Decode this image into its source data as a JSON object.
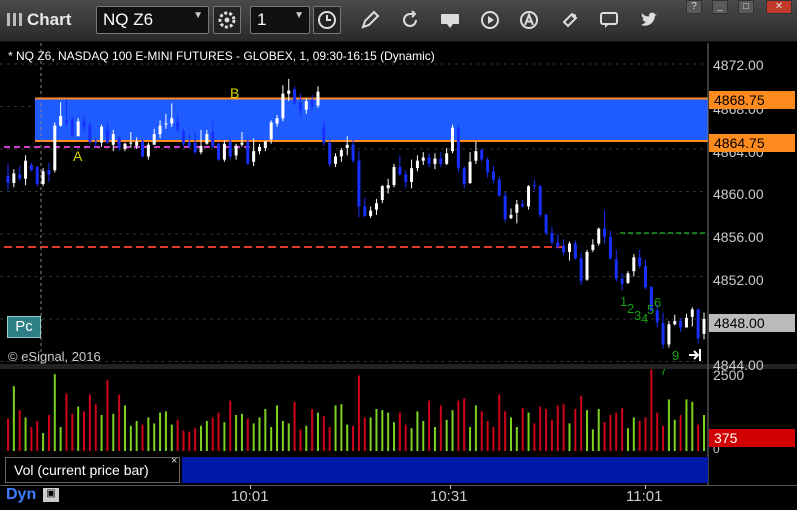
{
  "toolbar": {
    "app_title": "Chart",
    "symbol": "NQ Z6",
    "interval": "1"
  },
  "window": {
    "help": "?",
    "minimize": "_",
    "maximize": "□",
    "close": "✕"
  },
  "chart": {
    "info_line": "* NQ Z6, NASDAQ 100 E-MINI FUTURES - GLOBEX, 1, 09:30-16:15 (Dynamic)",
    "copyright": "© eSignal, 2016",
    "pc_label": "Pc",
    "label_a": "A",
    "label_b": "B",
    "wave_counts": [
      "1",
      "2",
      "3",
      "4",
      "5",
      "6",
      "7",
      "9"
    ],
    "price_axis": [
      "4872.00",
      "4868.00",
      "4864.00",
      "4860.00",
      "4856.00",
      "4852.00",
      "4844.00"
    ],
    "tags": {
      "upper_zone": "4868.75",
      "lower_zone": "4864.75",
      "current": "4848.00",
      "volume": "375"
    },
    "colors": {
      "zone": "#1e5cff",
      "zone_edge": "#ff8a1e",
      "up": "#ffffff",
      "down": "#1830ff",
      "red_line": "#e03a2a",
      "magenta_line": "#d040d0",
      "green_line": "#1aa01a"
    }
  },
  "volume_panel": {
    "legend": "Vol (current price bar)",
    "close": "×",
    "axis": [
      "2500",
      "0"
    ]
  },
  "time_axis": {
    "mode": "Dyn",
    "labels": [
      "10:01",
      "10:31",
      "11:01"
    ]
  },
  "chart_data": {
    "type": "candlestick",
    "y_axis": [
      4844,
      4872
    ],
    "zone": [
      4864.75,
      4868.75
    ],
    "current_price": 4848.0,
    "bars": [
      [
        4861.5,
        4862.6,
        4860.1,
        4860.8
      ],
      [
        4860.8,
        4862.1,
        4860.4,
        4861.7
      ],
      [
        4861.6,
        4862.4,
        4861.0,
        4861.2
      ],
      [
        4861.2,
        4863.4,
        4860.6,
        4862.9
      ],
      [
        4862.5,
        4862.7,
        4861.9,
        4862.0
      ],
      [
        4862.3,
        4862.4,
        4860.5,
        4860.7
      ],
      [
        4860.7,
        4862.2,
        4860.5,
        4861.9
      ],
      [
        4862.0,
        4862.7,
        4860.9,
        4861.6
      ],
      [
        4862.0,
        4866.5,
        4861.8,
        4866.2
      ],
      [
        4866.2,
        4868.4,
        4866.1,
        4867.1
      ],
      [
        4866.7,
        4868.7,
        4866.1,
        4866.5
      ],
      [
        4866.8,
        4867.1,
        4865.2,
        4865.3
      ],
      [
        4865.2,
        4866.9,
        4865.2,
        4866.6
      ],
      [
        4866.6,
        4867.1,
        4865.6,
        4866.1
      ],
      [
        4866.2,
        4866.6,
        4864.5,
        4864.7
      ],
      [
        4864.7,
        4865.0,
        4864.2,
        4864.6
      ],
      [
        4864.6,
        4866.3,
        4864.2,
        4866.1
      ],
      [
        4865.8,
        4866.5,
        4864.5,
        4864.6
      ],
      [
        4864.4,
        4865.8,
        4863.8,
        4865.4
      ],
      [
        4865.1,
        4865.2,
        4863.8,
        4864.1
      ],
      [
        4864.0,
        4864.6,
        4863.8,
        4864.5
      ],
      [
        4864.5,
        4865.6,
        4864.1,
        4864.6
      ],
      [
        4864.3,
        4865.1,
        4864.0,
        4864.7
      ],
      [
        4864.7,
        4864.9,
        4863.2,
        4863.3
      ],
      [
        4863.3,
        4864.6,
        4863.0,
        4864.4
      ],
      [
        4864.4,
        4865.9,
        4864.4,
        4865.4
      ],
      [
        4865.4,
        4866.7,
        4865.0,
        4866.2
      ],
      [
        4866.3,
        4867.3,
        4865.9,
        4866.4
      ],
      [
        4866.4,
        4868.3,
        4866.1,
        4866.9
      ],
      [
        4866.6,
        4867.2,
        4865.6,
        4865.8
      ],
      [
        4865.7,
        4865.9,
        4864.2,
        4864.5
      ],
      [
        4864.6,
        4865.4,
        4864.1,
        4864.3
      ],
      [
        4864.6,
        4865.6,
        4863.5,
        4863.7
      ],
      [
        4863.7,
        4865.8,
        4863.5,
        4864.3
      ],
      [
        4864.5,
        4865.8,
        4864.4,
        4865.4
      ],
      [
        4865.6,
        4866.6,
        4864.1,
        4864.2
      ],
      [
        4864.5,
        4864.6,
        4862.9,
        4863.0
      ],
      [
        4863.0,
        4864.8,
        4862.8,
        4864.5
      ],
      [
        4864.7,
        4865.0,
        4863.0,
        4863.3
      ],
      [
        4863.4,
        4864.5,
        4863.0,
        4864.3
      ],
      [
        4864.4,
        4865.6,
        4864.2,
        4864.6
      ],
      [
        4864.7,
        4865.0,
        4862.5,
        4862.6
      ],
      [
        4862.8,
        4865.0,
        4862.4,
        4863.8
      ],
      [
        4863.8,
        4864.5,
        4863.5,
        4864.2
      ],
      [
        4864.1,
        4864.8,
        4863.8,
        4864.7
      ],
      [
        4864.9,
        4866.7,
        4864.5,
        4866.5
      ],
      [
        4866.4,
        4867.2,
        4866.1,
        4866.9
      ],
      [
        4866.9,
        4870.0,
        4866.6,
        4869.2
      ],
      [
        4869.2,
        4870.6,
        4868.5,
        4869.5
      ],
      [
        4869.6,
        4869.9,
        4868.1,
        4868.3
      ],
      [
        4868.4,
        4869.2,
        4867.1,
        4867.6
      ],
      [
        4867.7,
        4868.8,
        4867.3,
        4868.5
      ],
      [
        4868.6,
        4869.1,
        4867.7,
        4868.0
      ],
      [
        4868.1,
        4869.9,
        4867.9,
        4869.4
      ],
      [
        4866.0,
        4866.6,
        4864.3,
        4864.6
      ],
      [
        4864.6,
        4864.8,
        4862.4,
        4862.6
      ],
      [
        4862.6,
        4863.6,
        4862.3,
        4863.3
      ],
      [
        4863.3,
        4864.1,
        4862.8,
        4863.9
      ],
      [
        4864.1,
        4865.2,
        4863.4,
        4864.4
      ],
      [
        4864.4,
        4864.9,
        4862.7,
        4862.9
      ],
      [
        4862.9,
        4863.8,
        4857.6,
        4858.6
      ],
      [
        4858.6,
        4859.4,
        4857.6,
        4857.7
      ],
      [
        4857.7,
        4858.6,
        4857.5,
        4858.2
      ],
      [
        4858.3,
        4859.3,
        4857.8,
        4858.9
      ],
      [
        4859.2,
        4860.6,
        4858.9,
        4860.5
      ],
      [
        4860.3,
        4861.2,
        4859.8,
        4860.6
      ],
      [
        4860.6,
        4862.6,
        4860.4,
        4862.3
      ],
      [
        4862.3,
        4863.4,
        4861.5,
        4861.6
      ],
      [
        4861.6,
        4862.0,
        4860.3,
        4860.9
      ],
      [
        4860.9,
        4863.0,
        4860.3,
        4862.2
      ],
      [
        4862.2,
        4863.4,
        4861.9,
        4862.9
      ],
      [
        4862.9,
        4863.7,
        4862.5,
        4863.2
      ],
      [
        4863.2,
        4863.6,
        4862.3,
        4862.6
      ],
      [
        4862.6,
        4863.6,
        4862.1,
        4863.1
      ],
      [
        4863.1,
        4863.7,
        4862.3,
        4862.6
      ],
      [
        4862.6,
        4864.1,
        4862.5,
        4863.6
      ],
      [
        4863.8,
        4866.3,
        4863.6,
        4866.0
      ],
      [
        4866.0,
        4866.2,
        4861.8,
        4862.2
      ],
      [
        4862.2,
        4862.4,
        4860.3,
        4860.7
      ],
      [
        4860.8,
        4863.7,
        4860.7,
        4862.8
      ],
      [
        4862.9,
        4864.7,
        4862.6,
        4863.8
      ],
      [
        4863.9,
        4864.1,
        4862.8,
        4863.0
      ],
      [
        4863.0,
        4863.2,
        4861.3,
        4861.8
      ],
      [
        4861.9,
        4862.4,
        4860.8,
        4861.1
      ],
      [
        4861.1,
        4861.4,
        4859.5,
        4859.6
      ],
      [
        4859.6,
        4860.0,
        4857.1,
        4857.4
      ],
      [
        4857.5,
        4858.4,
        4857.4,
        4857.8
      ],
      [
        4858.0,
        4859.2,
        4857.0,
        4858.8
      ],
      [
        4858.8,
        4859.2,
        4858.5,
        4858.6
      ],
      [
        4858.6,
        4860.6,
        4858.3,
        4860.5
      ],
      [
        4860.6,
        4861.1,
        4860.2,
        4860.5
      ],
      [
        4860.5,
        4860.6,
        4857.6,
        4857.8
      ],
      [
        4857.8,
        4857.9,
        4855.9,
        4856.1
      ],
      [
        4856.1,
        4856.7,
        4855.0,
        4855.2
      ],
      [
        4855.2,
        4856.0,
        4854.6,
        4854.8
      ],
      [
        4854.9,
        4855.5,
        4854.0,
        4854.3
      ],
      [
        4854.3,
        4855.3,
        4853.5,
        4855.1
      ],
      [
        4855.1,
        4855.4,
        4853.6,
        4853.7
      ],
      [
        4853.7,
        4854.2,
        4851.2,
        4851.6
      ],
      [
        4851.7,
        4854.5,
        4851.6,
        4854.3
      ],
      [
        4854.5,
        4855.5,
        4854.3,
        4855.0
      ],
      [
        4855.1,
        4856.6,
        4854.9,
        4856.5
      ],
      [
        4856.5,
        4858.2,
        4855.1,
        4855.7
      ],
      [
        4855.7,
        4856.3,
        4853.6,
        4853.7
      ],
      [
        4853.6,
        4854.5,
        4851.5,
        4851.8
      ],
      [
        4851.8,
        4852.3,
        4850.7,
        4851.3
      ],
      [
        4851.4,
        4852.5,
        4851.3,
        4852.3
      ],
      [
        4852.5,
        4854.1,
        4852.0,
        4853.8
      ],
      [
        4853.8,
        4854.5,
        4852.8,
        4853.0
      ],
      [
        4853.0,
        4853.6,
        4850.8,
        4851.0
      ],
      [
        4851.0,
        4851.1,
        4848.7,
        4848.8
      ],
      [
        4848.8,
        4849.4,
        4847.2,
        4847.7
      ],
      [
        4847.6,
        4848.6,
        4845.2,
        4845.6
      ],
      [
        4845.6,
        4847.8,
        4845.3,
        4847.5
      ],
      [
        4847.5,
        4848.4,
        4847.4,
        4847.8
      ],
      [
        4847.8,
        4848.1,
        4846.8,
        4847.2
      ],
      [
        4847.2,
        4848.5,
        4847.2,
        4848.1
      ],
      [
        4848.2,
        4849.1,
        4847.3,
        4848.9
      ],
      [
        4848.9,
        4849.0,
        4845.7,
        4846.2
      ],
      [
        4846.6,
        4848.6,
        4846.1,
        4848.0
      ]
    ],
    "volume": [
      270,
      540,
      340,
      280,
      200,
      250,
      150,
      300,
      640,
      200,
      480,
      310,
      370,
      330,
      470,
      390,
      300,
      590,
      310,
      470,
      380,
      210,
      250,
      220,
      280,
      230,
      320,
      330,
      220,
      260,
      170,
      160,
      190,
      210,
      250,
      280,
      320,
      240,
      420,
      300,
      310,
      270,
      230,
      280,
      350,
      200,
      380,
      250,
      230,
      410,
      180,
      210,
      350,
      320,
      290,
      200,
      380,
      390,
      220,
      210,
      630,
      280,
      280,
      350,
      340,
      320,
      240,
      320,
      220,
      190,
      330,
      250,
      420,
      200,
      380,
      260,
      340,
      420,
      440,
      200,
      380,
      330,
      250,
      200,
      470,
      330,
      280,
      200,
      360,
      320,
      230,
      370,
      350,
      260,
      380,
      390,
      230,
      350,
      460,
      340,
      180,
      350,
      240,
      300,
      320,
      360,
      190,
      280,
      250,
      280,
      680,
      320,
      210,
      430,
      260,
      300,
      430,
      410,
      220,
      300
    ]
  }
}
